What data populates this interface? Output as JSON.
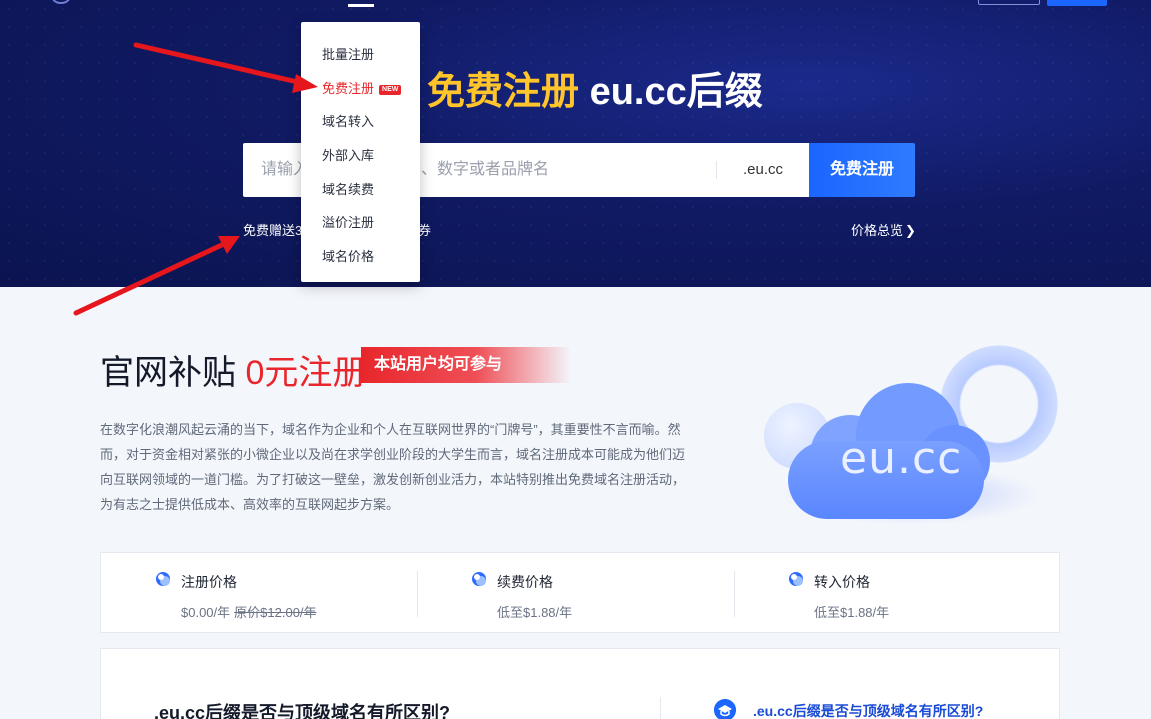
{
  "hero": {
    "title_accent": "免费注册",
    "title_rest": " eu.cc后缀",
    "search_placeholder": "请输入您想注册的字母、数字或者品牌名",
    "suffix": ".eu.cc",
    "register_button": "免费注册",
    "promo_text_head": "免费赠送3",
    "promo_text_tail": "券",
    "price_overview": "价格总览",
    "price_overview_chevron": "❯"
  },
  "dropdown": {
    "items": [
      {
        "label": "批量注册"
      },
      {
        "label": "免费注册",
        "badge": "NEW",
        "active": true
      },
      {
        "label": "域名转入"
      },
      {
        "label": "外部入库"
      },
      {
        "label": "域名续费"
      },
      {
        "label": "溢价注册"
      },
      {
        "label": "域名价格"
      }
    ]
  },
  "subsidy": {
    "title_prefix": "官网补贴 ",
    "title_red": "0元注册",
    "tag": "本站用户均可参与",
    "description": "在数字化浪潮风起云涌的当下，域名作为企业和个人在互联网世界的“门牌号”，其重要性不言而喻。然而，对于资金相对紧张的小微企业以及尚在求学创业阶段的大学生而言，域名注册成本可能成为他们迈向互联网领域的一道门槛。为了打破这一壁垒，激发创新创业活力，本站特别推出免费域名注册活动，为有志之士提供低成本、高效率的互联网起步方案。",
    "cloud_text": "eu.cc"
  },
  "prices": [
    {
      "label": "注册价格",
      "value": "$0.00/年",
      "original": "原价$12.00/年"
    },
    {
      "label": "续费价格",
      "value": "低至$1.88/年",
      "original": ""
    },
    {
      "label": "转入价格",
      "value": "低至$1.88/年",
      "original": ""
    }
  ],
  "faq": {
    "left_question": ".eu.cc后缀是否与顶级域名有所区别?",
    "right_question": ".eu.cc后缀是否与顶级域名有所区别?"
  },
  "colors": {
    "hero_bg": "#101a63",
    "accent_yellow": "#ffc52b",
    "brand_blue": "#1a66ff",
    "red": "#e8262b"
  },
  "icons": {
    "price_icon": "cloud-badge-icon",
    "faq_icon": "graduation-cap-icon",
    "annotation": "red-arrow-annotation"
  }
}
